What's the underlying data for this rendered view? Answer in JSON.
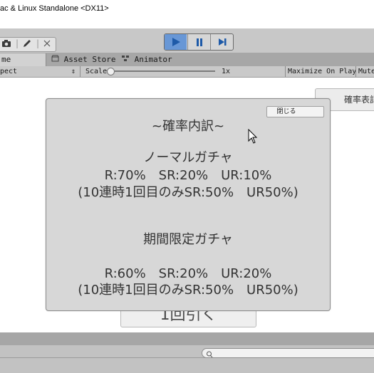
{
  "window": {
    "title": "ac & Linux Standalone <DX11>"
  },
  "toolbar": {
    "tools": [
      "camera-icon",
      "pencil-icon",
      "close-icon"
    ],
    "play_controls": [
      "play-icon",
      "pause-icon",
      "step-icon"
    ],
    "accent_color": "#6897d6"
  },
  "tabs": [
    {
      "label": "me"
    },
    {
      "label": "Asset Store",
      "icon": "store-icon"
    },
    {
      "label": "Animator",
      "icon": "animator-icon"
    }
  ],
  "game_bar": {
    "aspect_label": "pect",
    "scale_label": "Scale",
    "scale_value": "1x",
    "maximize_label": "Maximize On Play",
    "mute_label": "Mute"
  },
  "game": {
    "probability_button": "確率表記",
    "draw_button": "1回引く"
  },
  "panel": {
    "close_label": "閉じる",
    "title": "~確率内訳~",
    "normal": {
      "heading": "ノーマルガチャ",
      "rates": "R:70%　SR:20%　UR:10%",
      "note": "(10連時1回目のみSR:50%　UR50%)"
    },
    "limited": {
      "heading": "期間限定ガチャ",
      "rates": "R:60%　SR:20%　UR:20%",
      "note": "(10連時1回目のみSR:50%　UR50%)"
    }
  }
}
